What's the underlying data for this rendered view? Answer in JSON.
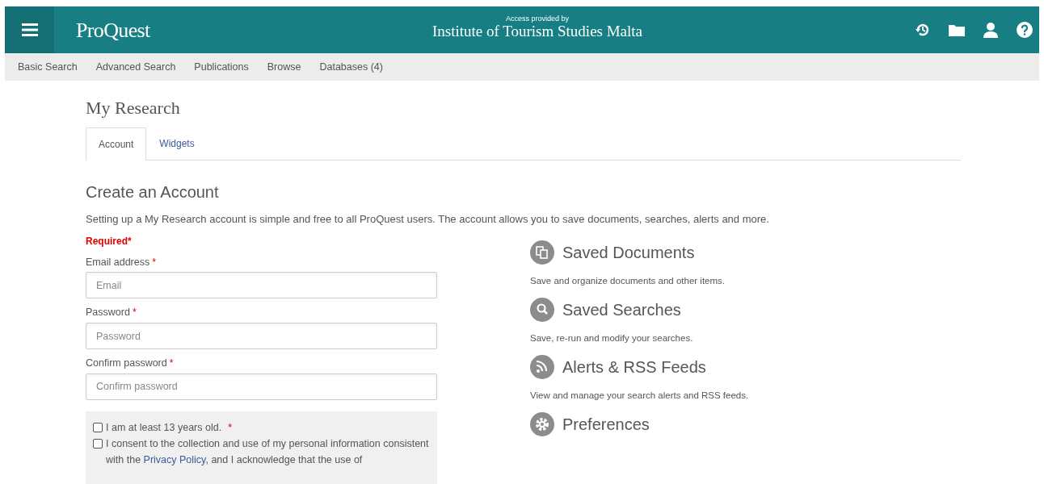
{
  "header": {
    "logo": "ProQuest",
    "access_caption": "Access provided by",
    "institution": "Institute of Tourism Studies Malta"
  },
  "nav": [
    "Basic Search",
    "Advanced Search",
    "Publications",
    "Browse",
    "Databases (4)"
  ],
  "page_title": "My Research",
  "tabs": [
    {
      "label": "Account",
      "selected": true
    },
    {
      "label": "Widgets",
      "selected": false
    }
  ],
  "section_title": "Create an Account",
  "intro": "Setting up a My Research account is simple and free to all ProQuest users. The account allows you to save documents, searches, alerts and more.",
  "required_note": "Required*",
  "fields": [
    {
      "label": "Email address",
      "required_mark": "*",
      "placeholder": "Email"
    },
    {
      "label": "Password",
      "required_mark": "*",
      "placeholder": "Password"
    },
    {
      "label": "Confirm password",
      "required_mark": "*",
      "placeholder": "Confirm password"
    }
  ],
  "agreements": [
    {
      "text_before": "I am at least 13 years old.",
      "required_mark": "*",
      "checked": false
    },
    {
      "text_before": "I consent to the collection and use of my personal information consistent with the",
      "link": "Privacy Policy",
      "text_after": ", and I acknowledge that the use of",
      "checked": false
    }
  ],
  "features": [
    {
      "kind": "documents",
      "title": "Saved Documents",
      "description": "Save and organize documents and other items."
    },
    {
      "kind": "search",
      "title": "Saved Searches",
      "description": "Save, re-run and modify your searches."
    },
    {
      "kind": "rss",
      "title": "Alerts & RSS Feeds",
      "description": "View and manage your search alerts and RSS feeds."
    },
    {
      "kind": "settings",
      "title": "Preferences"
    }
  ]
}
